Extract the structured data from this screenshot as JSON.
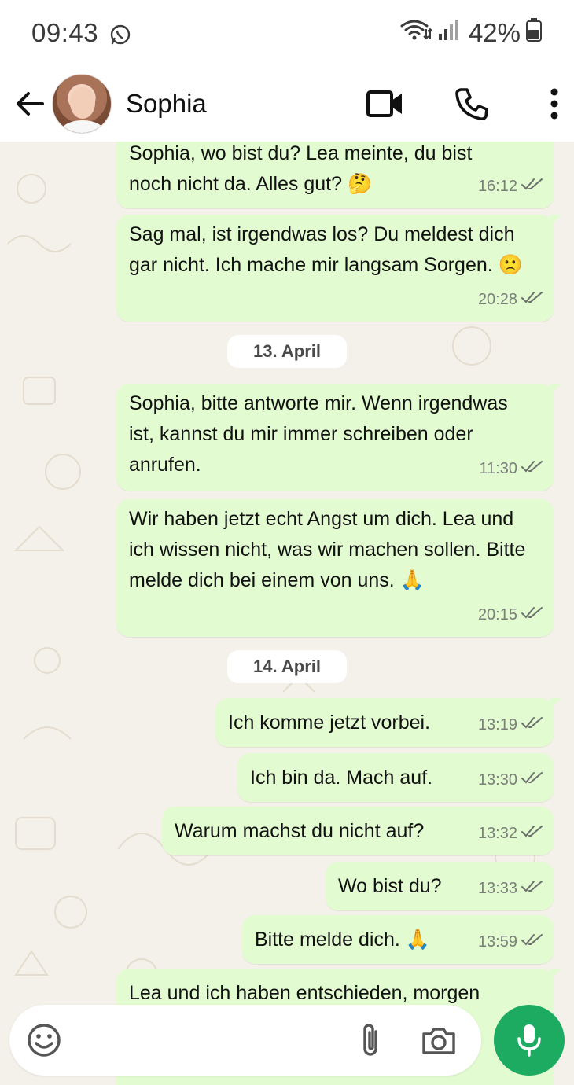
{
  "status_bar": {
    "time": "09:43",
    "battery": "42%",
    "icons": [
      "whatsapp-icon",
      "wifi-icon",
      "signal-icon",
      "battery-icon"
    ]
  },
  "header": {
    "contact_name": "Sophia",
    "icons": [
      "back-arrow-icon",
      "avatar",
      "video-call-icon",
      "voice-call-icon",
      "more-options-icon"
    ]
  },
  "messages": [
    {
      "text": "Sophia, wo bist du? Lea meinte, du bist noch nicht da. Alles gut? 🤔",
      "time": "16:12"
    },
    {
      "text": "Sag mal, ist irgendwas los? Du meldest dich gar nicht. Ich mache mir langsam Sorgen. 🙁",
      "time": "20:28"
    },
    {
      "text": "Sophia, bitte antworte mir. Wenn irgendwas ist, kannst du mir immer schreiben oder anrufen.",
      "time": "11:30"
    },
    {
      "text": "Wir haben jetzt echt Angst um dich. Lea und ich wissen nicht, was wir machen sollen. Bitte melde dich bei einem von uns. 🙏",
      "time": "20:15"
    },
    {
      "text": "Ich komme jetzt vorbei.",
      "time": "13:19"
    },
    {
      "text": "Ich bin da. Mach auf.",
      "time": "13:30"
    },
    {
      "text": "Warum machst du nicht auf?",
      "time": "13:32"
    },
    {
      "text": "Wo bist du?",
      "time": "13:33"
    },
    {
      "text": "Bitte melde dich. 🙏",
      "time": "13:59"
    },
    {
      "text": "Lea und ich haben entschieden, morgen",
      "time": ""
    }
  ],
  "date_separators": [
    "13. April",
    "14. April"
  ],
  "input": {
    "placeholder": "",
    "icons": [
      "emoji-icon",
      "attach-icon",
      "camera-icon",
      "mic-icon"
    ]
  },
  "colors": {
    "bubble_outgoing": "#e3fbd1",
    "chat_background": "#f4f1ea",
    "mic_button": "#1daa61",
    "read_ticks": "#6b6f6b"
  }
}
